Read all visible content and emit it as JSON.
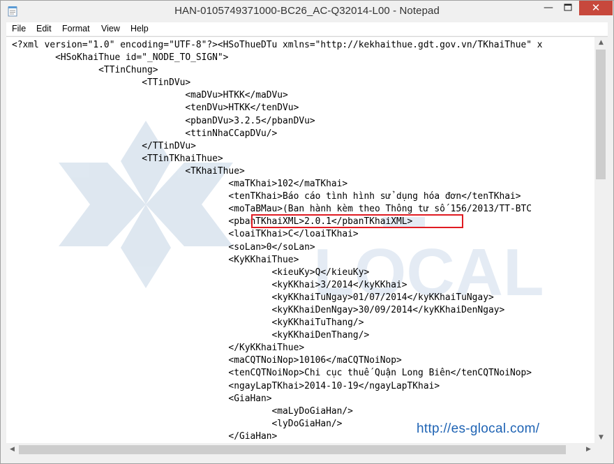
{
  "window": {
    "title": "HAN-0105749371000-BC26_AC-Q32014-L00 - Notepad",
    "minimize_glyph": "—",
    "close_glyph": "✕"
  },
  "menu": {
    "file": "File",
    "edit": "Edit",
    "format": "Format",
    "view": "View",
    "help": "Help"
  },
  "document": {
    "lines": [
      "<?xml version=\"1.0\" encoding=\"UTF-8\"?><HSoThueDTu xmlns=\"http://kekhaithue.gdt.gov.vn/TKhaiThue\" x",
      "\t<HSoKhaiThue id=\"_NODE_TO_SIGN\">",
      "\t\t<TTinChung>",
      "\t\t\t<TTinDVu>",
      "\t\t\t\t<maDVu>HTKK</maDVu>",
      "\t\t\t\t<tenDVu>HTKK</tenDVu>",
      "\t\t\t\t<pbanDVu>3.2.5</pbanDVu>",
      "\t\t\t\t<ttinNhaCCapDVu/>",
      "\t\t\t</TTinDVu>",
      "\t\t\t<TTinTKhaiThue>",
      "\t\t\t\t<TKhaiThue>",
      "\t\t\t\t\t<maTKhai>102</maTKhai>",
      "\t\t\t\t\t<tenTKhai>Báo cáo tình hình sử dụng hóa đơn</tenTKhai>",
      "\t\t\t\t\t<moTaBMau>(Ban hành kèm theo Thông tư số 156/2013/TT-BTC",
      "\t\t\t\t\t<pbanTKhaiXML>2.0.1</pbanTKhaiXML>",
      "\t\t\t\t\t<loaiTKhai>C</loaiTKhai>",
      "\t\t\t\t\t<soLan>0</soLan>",
      "\t\t\t\t\t<KyKKhaiThue>",
      "\t\t\t\t\t\t<kieuKy>Q</kieuKy>",
      "\t\t\t\t\t\t<kyKKhai>3/2014</kyKKhai>",
      "\t\t\t\t\t\t<kyKKhaiTuNgay>01/07/2014</kyKKhaiTuNgay>",
      "\t\t\t\t\t\t<kyKKhaiDenNgay>30/09/2014</kyKKhaiDenNgay>",
      "\t\t\t\t\t\t<kyKKhaiTuThang/>",
      "\t\t\t\t\t\t<kyKKhaiDenThang/>",
      "\t\t\t\t\t</KyKKhaiThue>",
      "\t\t\t\t\t<maCQTNoiNop>10106</maCQTNoiNop>",
      "\t\t\t\t\t<tenCQTNoiNop>Chi cục thuế Quận Long Biên</tenCQTNoiNop>",
      "\t\t\t\t\t<ngayLapTKhai>2014-10-19</ngayLapTKhai>",
      "\t\t\t\t\t<GiaHan>",
      "\t\t\t\t\t\t<maLyDoGiaHan/>",
      "\t\t\t\t\t\t<lyDoGiaHan/>",
      "\t\t\t\t\t</GiaHan>"
    ]
  },
  "watermark": {
    "brand_text": "GLOCAL",
    "url": "http://es-glocal.com/"
  },
  "colors": {
    "highlight_border": "#e01b22",
    "watermark_url": "#1e63b4",
    "close_button": "#c7483c"
  },
  "icons": {
    "app": "notepad-icon",
    "minimize": "minimize-icon",
    "maximize": "maximize-icon",
    "close": "close-icon"
  }
}
